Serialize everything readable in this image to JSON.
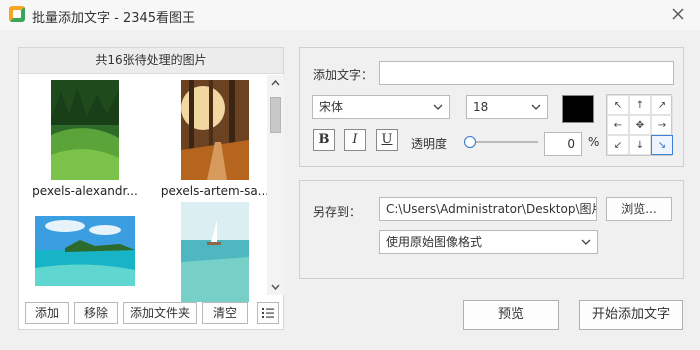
{
  "window": {
    "title": "批量添加文字 - 2345看图王"
  },
  "file_panel": {
    "header": "共16张待处理的图片",
    "images": [
      {
        "name": "pexels-alexandr...",
        "icon": "forest-hill-image"
      },
      {
        "name": "pexels-artem-sa...",
        "icon": "autumn-path-image"
      },
      {
        "name": "",
        "icon": "tropical-beach-image"
      },
      {
        "name": "",
        "icon": "sailboat-sea-image"
      }
    ],
    "buttons": {
      "add": "添加",
      "remove": "移除",
      "add_folder": "添加文件夹",
      "clear": "清空"
    }
  },
  "text_settings": {
    "label": "添加文字：",
    "text_value": "",
    "font": "宋体",
    "size": "18",
    "color": "#000000",
    "bold": "B",
    "italic": "I",
    "underline": "U",
    "opacity_label": "透明度",
    "opacity_value": "0",
    "percent": "%",
    "position_selected": "bottom-right"
  },
  "save_settings": {
    "label": "另存到：",
    "path": "C:\\Users\\Administrator\\Desktop\\图片",
    "browse": "浏览...",
    "format": "使用原始图像格式"
  },
  "footer": {
    "preview": "预览",
    "start": "开始添加文字"
  }
}
